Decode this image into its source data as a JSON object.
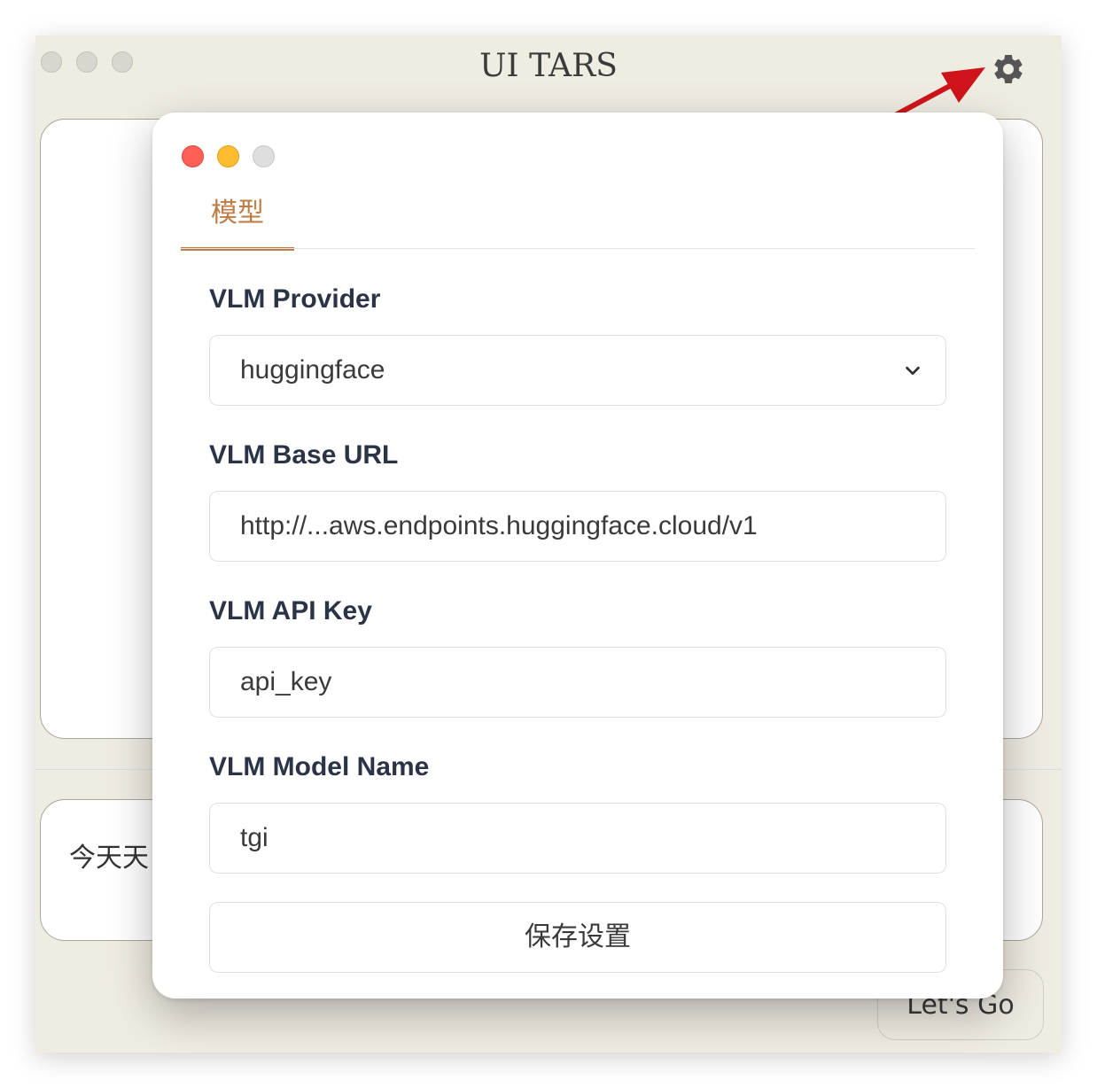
{
  "app": {
    "title": "UI TARS",
    "input_preview": "今天天",
    "go_label": "Let's Go",
    "settings_icon": "gear-icon"
  },
  "dialog": {
    "tab": "模型",
    "fields": {
      "provider": {
        "label": "VLM Provider",
        "value": "huggingface"
      },
      "base_url": {
        "label": "VLM Base URL",
        "value": "http://...aws.endpoints.huggingface.cloud/v1"
      },
      "api_key": {
        "label": "VLM API Key",
        "value": "api_key"
      },
      "model_name": {
        "label": "VLM Model Name",
        "value": "tgi"
      }
    },
    "save_label": "保存设置"
  },
  "colors": {
    "accent": "#c07c46",
    "window_bg": "#efece2",
    "annotation_arrow": "#d0141b"
  }
}
